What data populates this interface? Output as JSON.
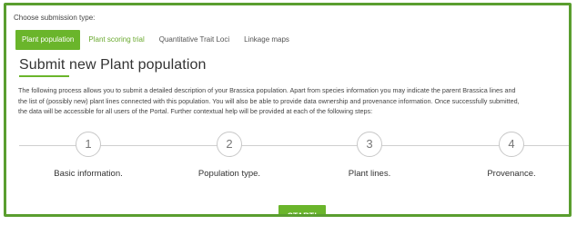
{
  "header": {
    "choose_label": "Choose submission type:"
  },
  "tabs": [
    {
      "label": "Plant population",
      "active": true
    },
    {
      "label": "Plant scoring trial",
      "active": false
    },
    {
      "label": "Quantitative Trait Loci",
      "active": false
    },
    {
      "label": "Linkage maps",
      "active": false
    }
  ],
  "page": {
    "title": "Submit new Plant population",
    "description_lines": [
      "The following process allows you to submit a detailed description of your Brassica population. Apart from species information you may indicate the parent Brassica lines and",
      "the list of (possibly new) plant lines connected with this population. You will also be able to provide data ownership and provenance information. Once successfully submitted,",
      "the data will be accessible for all users of the Portal. Further contextual help will be provided at each of the following steps:"
    ]
  },
  "steps": [
    {
      "number": "1",
      "label": "Basic information."
    },
    {
      "number": "2",
      "label": "Population type."
    },
    {
      "number": "3",
      "label": "Plant lines."
    },
    {
      "number": "4",
      "label": "Provenance."
    }
  ],
  "actions": {
    "start_label": "START!"
  },
  "colors": {
    "accent": "#6ab52b",
    "border": "#5a9e2f"
  }
}
